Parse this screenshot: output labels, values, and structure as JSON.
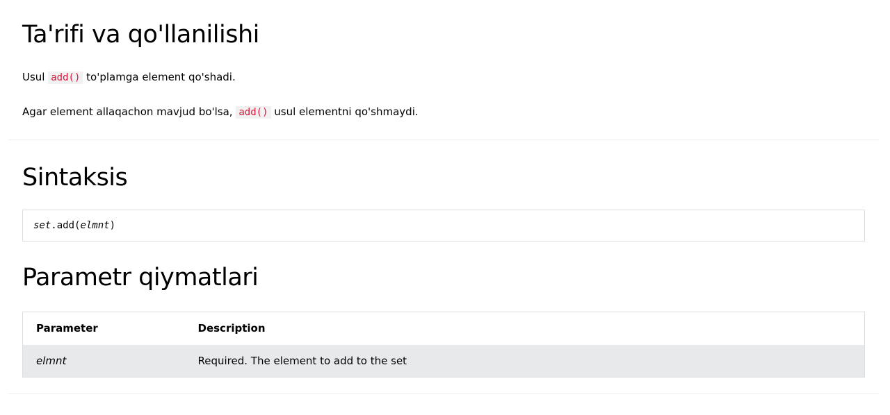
{
  "section1": {
    "heading": "Ta'rifi va qo'llanilishi",
    "para1": {
      "before": "Usul ",
      "code": "add()",
      "after": " to'plamga element qo'shadi."
    },
    "para2": {
      "before": "Agar element allaqachon mavjud bo'lsa, ",
      "code": "add()",
      "after": " usul elementni qo'shmaydi."
    }
  },
  "section2": {
    "heading": "Sintaksis",
    "syntax": {
      "obj": "set",
      "method": ".add(",
      "param": "elmnt",
      "close": ")"
    }
  },
  "section3": {
    "heading": "Parametr qiymatlari",
    "table": {
      "headers": [
        "Parameter",
        "Description"
      ],
      "rows": [
        {
          "param": "elmnt",
          "description": "Required. The element to add to the set"
        }
      ]
    }
  }
}
